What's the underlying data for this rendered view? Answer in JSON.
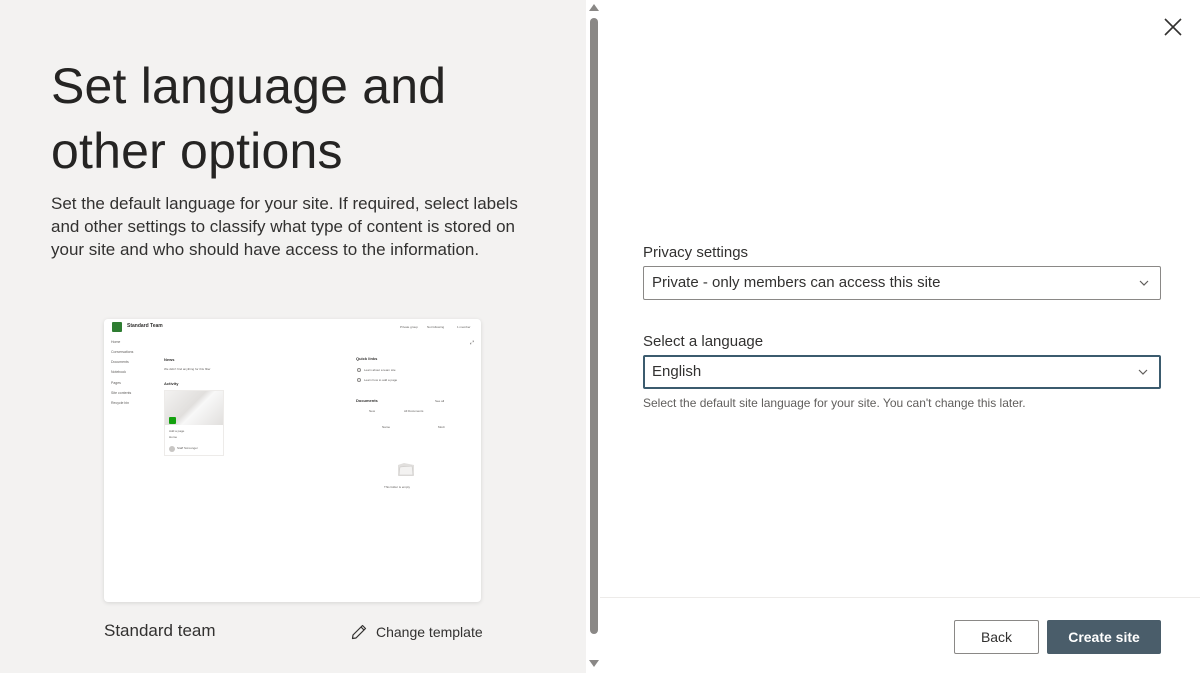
{
  "left": {
    "title": "Set language and other options",
    "description": "Set the default language for your site. If required, select labels and other settings to classify what type of content is stored on your site and who should have access to the information.",
    "template_name": "Standard team",
    "change_template_label": "Change template",
    "preview": {
      "site_name": "Standard Team",
      "top_actions": [
        "Private group",
        "Not following",
        "1 member"
      ],
      "nav": [
        "Home",
        "Conversations",
        "Documents",
        "Notebook",
        "Pages",
        "Site contents",
        "Recycle bin"
      ],
      "news_heading": "News",
      "news_text": "We didn't find anything for this filter",
      "activity_heading": "Activity",
      "activity_card_title": "Add a page",
      "activity_card_sub": "Home",
      "activity_card_person": "Staff Scrounger",
      "quick_links_heading": "Quick links",
      "quick_links": [
        "Learn about a team site",
        "Learn how to add a page"
      ],
      "documents_heading": "Documents",
      "documents_see_all": "See all",
      "documents_new": "New",
      "documents_view": "All Documents",
      "documents_col_name": "Name",
      "documents_col_modified": "Modi",
      "empty_text": "This folder is empty"
    }
  },
  "right": {
    "privacy": {
      "label": "Privacy settings",
      "value": "Private - only members can access this site"
    },
    "language": {
      "label": "Select a language",
      "value": "English",
      "help": "Select the default site language for your site. You can't change this later."
    },
    "buttons": {
      "back": "Back",
      "create": "Create site"
    }
  },
  "icons": {
    "close": "close-icon",
    "edit": "pencil-icon",
    "chevron": "chevron-down-icon"
  },
  "colors": {
    "left_bg": "#f3f2f1",
    "primary_button": "#4a5d6a",
    "focused_border": "#3b5b6e"
  }
}
